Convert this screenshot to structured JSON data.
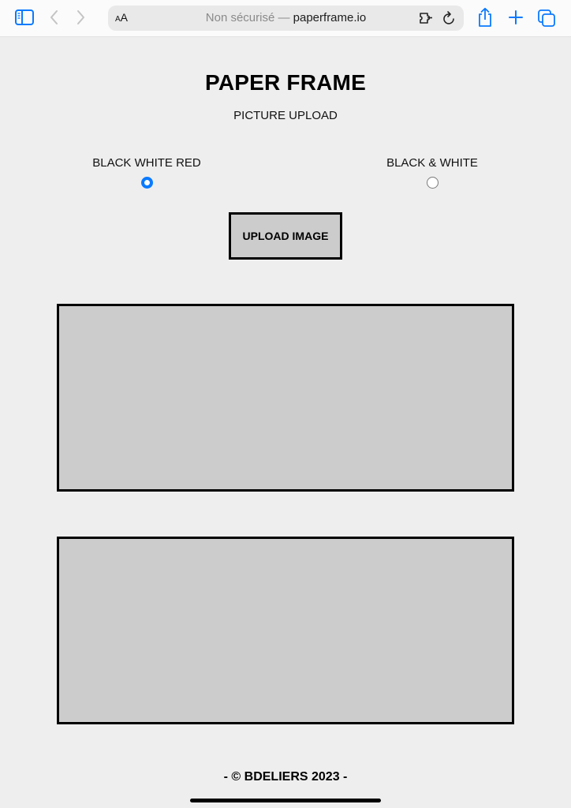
{
  "browser": {
    "address_bar": {
      "text_size_label_small": "A",
      "text_size_label_large": "A",
      "security_status": "Non sécurisé",
      "separator": " — ",
      "host": "paperframe.io"
    },
    "icons": {
      "sidebar": "sidebar-icon",
      "back": "chevron-left-icon",
      "forward": "chevron-right-icon",
      "extension": "extension-icon",
      "reload": "reload-icon",
      "share": "share-icon",
      "new_tab": "plus-icon",
      "tabs": "tabs-overview-icon"
    },
    "accent_color": "#0a7aff"
  },
  "page": {
    "title": "PAPER FRAME",
    "subtitle": "PICTURE UPLOAD",
    "color_modes": [
      {
        "label": "BLACK WHITE RED",
        "selected": true
      },
      {
        "label": "BLACK & WHITE",
        "selected": false
      }
    ],
    "upload_button_label": "UPLOAD IMAGE",
    "previews": [
      {
        "name": "preview-1",
        "fill": "#cccccc"
      },
      {
        "name": "preview-2",
        "fill": "#cccccc"
      }
    ],
    "footer": "- © BDELIERS 2023 -"
  }
}
